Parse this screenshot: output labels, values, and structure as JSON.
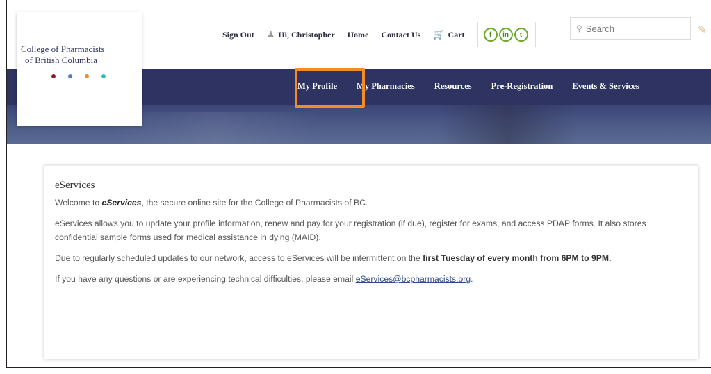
{
  "logo": {
    "line1": "College of Pharmacists",
    "line2": "of British Columbia",
    "dot_colors": [
      "#8b1a2a",
      "#4d7cc2",
      "#f28c28",
      "#35b7c9"
    ]
  },
  "topbar": {
    "sign_out": "Sign Out",
    "greeting": "Hi, Christopher",
    "home": "Home",
    "contact": "Contact Us",
    "cart": "Cart",
    "social": [
      "f",
      "in",
      "t"
    ],
    "search_placeholder": "Search"
  },
  "nav": {
    "items": [
      "My Profile",
      "My Pharmacies",
      "Resources",
      "Pre-Registration",
      "Events & Services"
    ],
    "highlighted": "My Profile",
    "highlight_color": "#f28c28",
    "bar_color": "#2e3362"
  },
  "content": {
    "title": "eServices",
    "p1_pre": "Welcome to ",
    "p1_bold": "eServices",
    "p1_post": ", the secure online site for the College of Pharmacists of BC.",
    "p2": "eServices allows you to update your profile information, renew and pay for your registration (if due), register for exams, and access PDAP forms. It also stores confidential sample forms used for medical assistance in dying (MAID).",
    "p3_pre": "Due to regularly scheduled updates to our network, access to eServices will be intermittent on the ",
    "p3_bold": "first Tuesday of every month from 6PM to 9PM.",
    "p4_pre": "If you have any questions or are experiencing technical difficulties, please email ",
    "p4_link": "eServices@bcpharmacists.org",
    "p4_post": "."
  }
}
